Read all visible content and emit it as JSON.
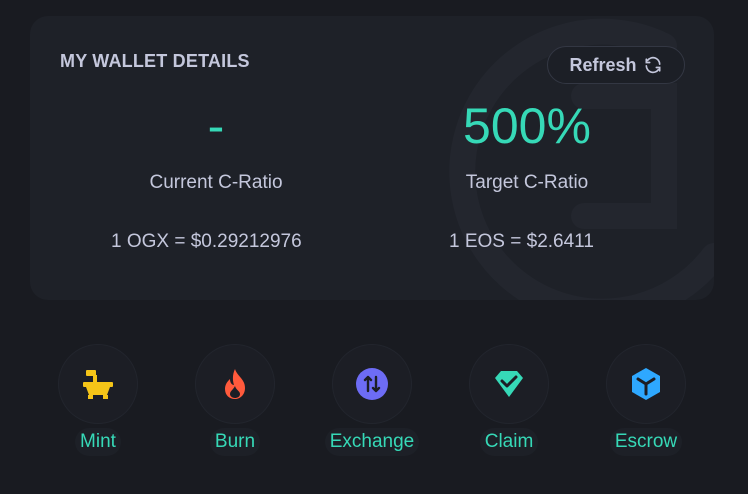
{
  "wallet": {
    "title": "MY WALLET DETAILS",
    "refresh_label": "Refresh",
    "current_ratio_value": "-",
    "current_ratio_label": "Current C-Ratio",
    "target_ratio_value": "500%",
    "target_ratio_label": "Target C-Ratio",
    "ogx_price": "1 OGX = $0.29212976",
    "eos_price": "1 EOS = $2.6411"
  },
  "actions": [
    {
      "label": "Mint",
      "icon": "mint-icon",
      "color": "#f5c518"
    },
    {
      "label": "Burn",
      "icon": "fire-icon",
      "color": "#ff5a3c"
    },
    {
      "label": "Exchange",
      "icon": "exchange-icon",
      "color": "#6d6cf5"
    },
    {
      "label": "Claim",
      "icon": "claim-icon",
      "color": "#36d9b7"
    },
    {
      "label": "Escrow",
      "icon": "cube-icon",
      "color": "#2ea8ff"
    }
  ],
  "colors": {
    "accent": "#36d9b7",
    "background": "#191b21",
    "card": "#1e2128",
    "text": "#c4c7dc"
  }
}
